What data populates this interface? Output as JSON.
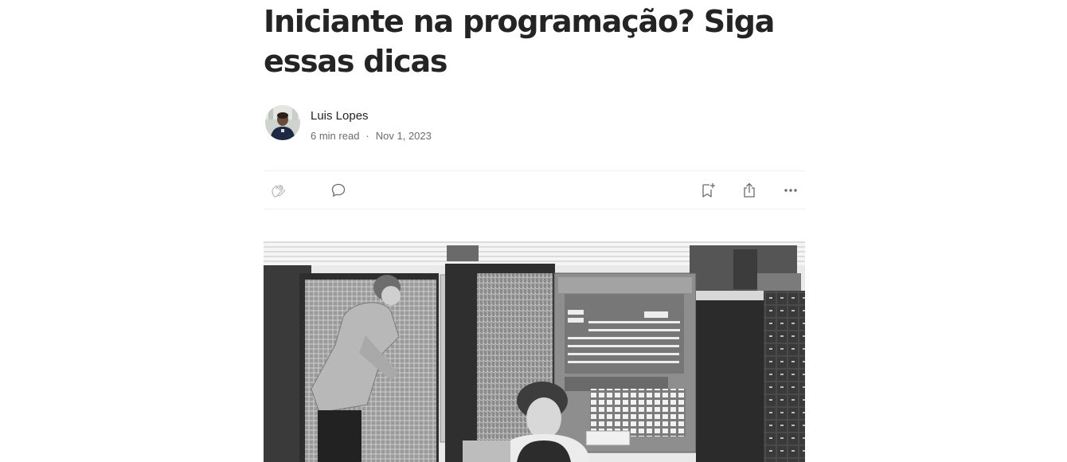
{
  "article": {
    "title": "Iniciante na programação? Siga essas dicas",
    "author": {
      "name": "Luis Lopes",
      "avatar_icon": "author-avatar"
    },
    "meta": {
      "read_time": "6 min read",
      "separator": "·",
      "date": "Nov 1, 2023"
    },
    "actions": {
      "clap_icon": "clap-icon",
      "comment_icon": "comment-icon",
      "bookmark_icon": "bookmark-add-icon",
      "share_icon": "share-icon",
      "more_icon": "more-icon"
    },
    "hero_image": {
      "description_icon": "hero-image-vintage-computer"
    }
  },
  "colors": {
    "text": "#242424",
    "meta": "#6b6b6b",
    "divider": "#f0f0f0"
  }
}
